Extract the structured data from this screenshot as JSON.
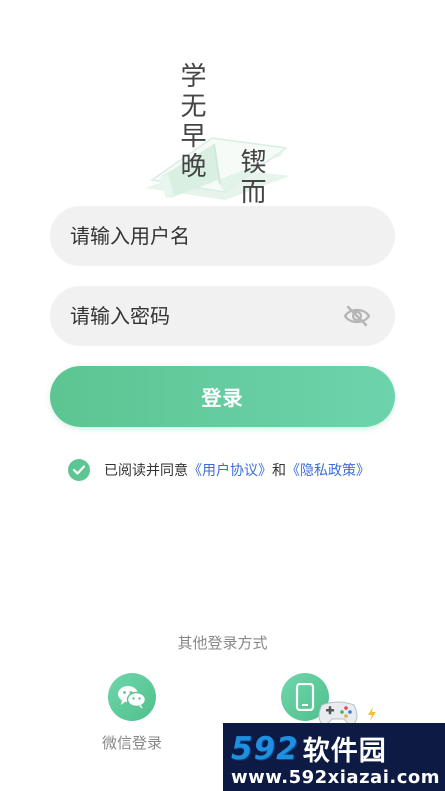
{
  "logo": {
    "motto_line1": "学无早晚",
    "motto_line2": "锲而不舍"
  },
  "form": {
    "username_placeholder": "请输入用户名",
    "password_placeholder": "请输入密码",
    "login_label": "登录"
  },
  "agreement": {
    "prefix": "已阅读并同意",
    "user_agreement": "《用户协议》",
    "and": "和",
    "privacy_policy": "《隐私政策》"
  },
  "other_login": {
    "title": "其他登录方式",
    "wechat_label": "微信登录"
  },
  "watermark": {
    "brand_number": "592",
    "brand_text": "软件园",
    "url": "www.592xiazai.com"
  },
  "colors": {
    "accent_green": "#5cc592",
    "link_blue": "#3b6fd6",
    "field_bg": "#f1f1f1",
    "watermark_bg": "#0d1a44",
    "watermark_blue": "#1f8fe0"
  },
  "icons": {
    "password_toggle": "eye-off-icon",
    "agree_check": "check-circle-icon",
    "wechat": "wechat-icon",
    "phone": "phone-icon"
  }
}
